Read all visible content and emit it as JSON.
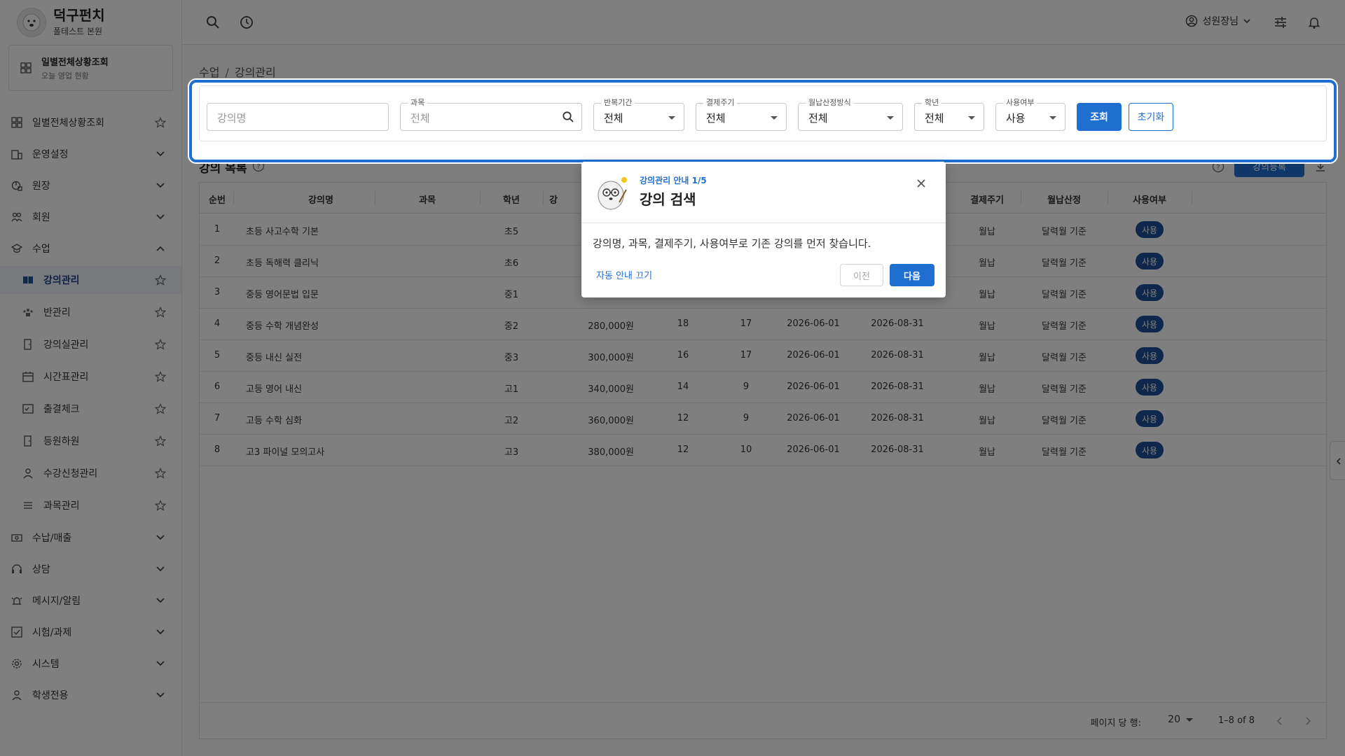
{
  "brand": {
    "name": "덕구펀치",
    "branch": "폴테스트 본원"
  },
  "quick_card": {
    "title": "일별전체상황조회",
    "subtitle": "오늘 영업 현황"
  },
  "sidebar": {
    "items": [
      {
        "label": "일별전체상황조회",
        "icon": "grid-icon",
        "right": "star"
      },
      {
        "label": "운영설정",
        "icon": "building-icon",
        "right": "chevron-down"
      },
      {
        "label": "원장",
        "icon": "chart-icon",
        "right": "chevron-down"
      },
      {
        "label": "회원",
        "icon": "people-icon",
        "right": "chevron-down"
      },
      {
        "label": "수업",
        "icon": "cap-icon",
        "right": "chevron-up"
      },
      {
        "label": "강의관리",
        "icon": "book-icon",
        "right": "star",
        "sub": true,
        "active": true
      },
      {
        "label": "반관리",
        "icon": "group-icon",
        "right": "star",
        "sub": true
      },
      {
        "label": "강의실관리",
        "icon": "door-icon",
        "right": "star",
        "sub": true
      },
      {
        "label": "시간표관리",
        "icon": "calendar-icon",
        "right": "star",
        "sub": true
      },
      {
        "label": "출결체크",
        "icon": "check-list-icon",
        "right": "star",
        "sub": true
      },
      {
        "label": "등원하원",
        "icon": "door-icon",
        "right": "star",
        "sub": true
      },
      {
        "label": "수강신청관리",
        "icon": "person-icon",
        "right": "star",
        "sub": true
      },
      {
        "label": "과목관리",
        "icon": "list-icon",
        "right": "star",
        "sub": true
      },
      {
        "label": "수납/매출",
        "icon": "money-icon",
        "right": "chevron-down"
      },
      {
        "label": "상담",
        "icon": "headset-icon",
        "right": "chevron-down"
      },
      {
        "label": "메시지/알림",
        "icon": "bell-icon",
        "right": "chevron-down"
      },
      {
        "label": "시험/과제",
        "icon": "checkbox-icon",
        "right": "chevron-down"
      },
      {
        "label": "시스템",
        "icon": "gear-icon",
        "right": "chevron-down"
      },
      {
        "label": "학생전용",
        "icon": "person-icon",
        "right": "chevron-down"
      }
    ]
  },
  "topbar": {
    "user_name": "성원장님"
  },
  "breadcrumb": {
    "parent": "수업",
    "current": "강의관리"
  },
  "filters": {
    "lecture_name_placeholder": "강의명",
    "subject_label": "과목",
    "subject_placeholder": "전체",
    "repeat_label": "반복기간",
    "repeat_value": "전체",
    "billing_label": "결제주기",
    "billing_value": "전체",
    "monthly_label": "월납산정방식",
    "monthly_value": "전체",
    "grade_label": "학년",
    "grade_value": "전체",
    "use_label": "사용여부",
    "use_value": "사용",
    "search_btn": "조회",
    "reset_btn": "초기화"
  },
  "list": {
    "title": "강의 목록",
    "add_btn": "강의등록"
  },
  "table": {
    "headers": [
      "순번",
      "강의명",
      "과목",
      "학년",
      "강",
      "결제주기",
      "월납산정",
      "사용여부"
    ],
    "rows": [
      {
        "no": "1",
        "name": "초등 사고수학 기본",
        "grade": "초5",
        "fee": "",
        "a": "",
        "b": "",
        "start": "",
        "end": "",
        "cycle": "월납",
        "calc": "달력월 기준",
        "use": "사용"
      },
      {
        "no": "2",
        "name": "초등 독해력 클리닉",
        "grade": "초6",
        "fee": "",
        "a": "",
        "b": "",
        "start": "",
        "end": "",
        "cycle": "월납",
        "calc": "달력월 기준",
        "use": "사용"
      },
      {
        "no": "3",
        "name": "중등 영어문법 입문",
        "grade": "중1",
        "fee": "",
        "a": "",
        "b": "",
        "start": "",
        "end": "",
        "cycle": "월납",
        "calc": "달력월 기준",
        "use": "사용"
      },
      {
        "no": "4",
        "name": "중등 수학 개념완성",
        "grade": "중2",
        "fee": "280,000원",
        "a": "18",
        "b": "17",
        "start": "2026-06-01",
        "end": "2026-08-31",
        "cycle": "월납",
        "calc": "달력월 기준",
        "use": "사용"
      },
      {
        "no": "5",
        "name": "중등 내신 실전",
        "grade": "중3",
        "fee": "300,000원",
        "a": "16",
        "b": "17",
        "start": "2026-06-01",
        "end": "2026-08-31",
        "cycle": "월납",
        "calc": "달력월 기준",
        "use": "사용"
      },
      {
        "no": "6",
        "name": "고등 영어 내신",
        "grade": "고1",
        "fee": "340,000원",
        "a": "14",
        "b": "9",
        "start": "2026-06-01",
        "end": "2026-08-31",
        "cycle": "월납",
        "calc": "달력월 기준",
        "use": "사용"
      },
      {
        "no": "7",
        "name": "고등 수학 심화",
        "grade": "고2",
        "fee": "360,000원",
        "a": "12",
        "b": "9",
        "start": "2026-06-01",
        "end": "2026-08-31",
        "cycle": "월납",
        "calc": "달력월 기준",
        "use": "사용"
      },
      {
        "no": "8",
        "name": "고3 파이널 모의고사",
        "grade": "고3",
        "fee": "380,000원",
        "a": "12",
        "b": "10",
        "start": "2026-06-01",
        "end": "2026-08-31",
        "cycle": "월납",
        "calc": "달력월 기준",
        "use": "사용"
      }
    ]
  },
  "pagination": {
    "per_page_label": "페이지 당 행:",
    "per_page_value": "20",
    "range": "1–8 of 8"
  },
  "guide": {
    "step": "강의관리 안내 1/5",
    "title": "강의 검색",
    "body": "강의명, 과목, 결제주기, 사용여부로 기존 강의를 먼저 찾습니다.",
    "auto_off": "자동 안내 끄기",
    "prev": "이전",
    "next": "다음"
  },
  "colors": {
    "accent": "#1f6fd0",
    "badge": "#1f4f9a",
    "active_nav_bg": "#eef2fb"
  }
}
